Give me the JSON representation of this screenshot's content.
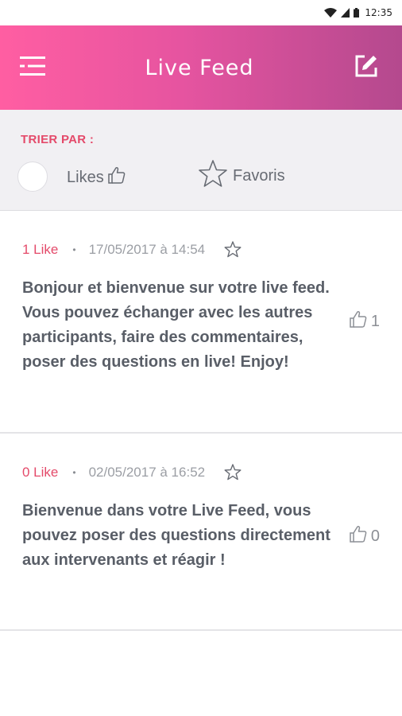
{
  "status_bar": {
    "time": "12:35"
  },
  "app_bar": {
    "title": "Live Feed"
  },
  "sort": {
    "label": "TRIER PAR :",
    "likes": "Likes",
    "favorites": "Favoris"
  },
  "posts": [
    {
      "likes_label": "1 Like",
      "date": "17/05/2017 à 14:54",
      "text": "Bonjour et bienvenue sur votre live feed. Vous pouvez échanger avec les autres participants, faire des commentaires, poser des questions en live! Enjoy!",
      "like_count": "1"
    },
    {
      "likes_label": "0 Like",
      "date": "02/05/2017 à 16:52",
      "text": "Bienvenue dans votre Live Feed, vous pouvez poser des questions directement aux intervenants et réagir !",
      "like_count": "0"
    }
  ],
  "colors": {
    "accent": "#e44a6a",
    "gradient_start": "#ff5ea2",
    "gradient_end": "#b4498e"
  },
  "icons": [
    "wifi-icon",
    "signal-icon",
    "battery-icon",
    "menu-icon",
    "edit-icon",
    "thumbs-up-icon",
    "star-icon"
  ]
}
